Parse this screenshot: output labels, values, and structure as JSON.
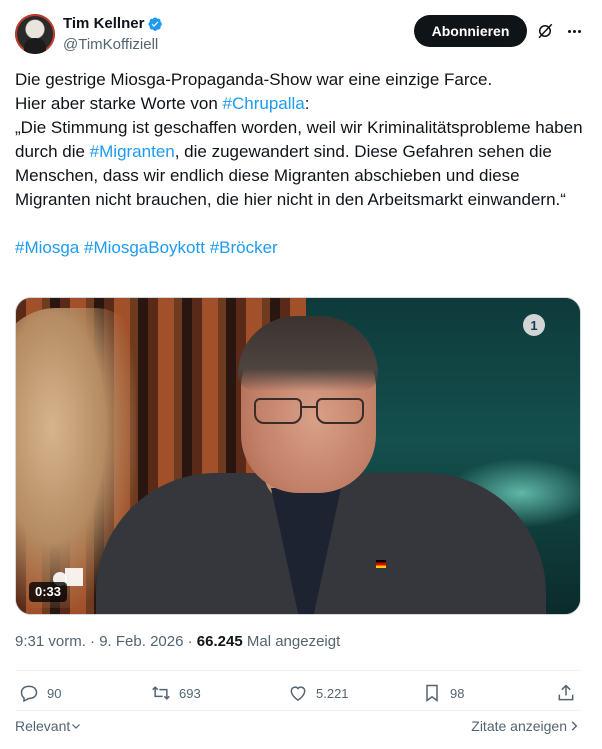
{
  "author": {
    "display_name": "Tim Kellner",
    "handle": "@TimKoffiziell",
    "verified": true
  },
  "header": {
    "subscribe_label": "Abonnieren",
    "icons": [
      "verified-badge-icon",
      "grok-icon",
      "more-icon"
    ]
  },
  "tweet": {
    "line1": "Die gestrige Miosga-Propaganda-Show war eine einzige Farce.",
    "line2_prefix": "Hier aber starke Worte von ",
    "line2_tag": "#Chrupalla",
    "line2_suffix": ":",
    "quote_part1": "„Die Stimmung ist geschaffen worden, weil wir Kriminalitätsprobleme haben durch die ",
    "quote_tag": "#Migranten",
    "quote_part2": ", die zugewandert sind. Diese Gefahren sehen die Menschen, dass wir endlich diese Migranten abschieben und diese Migranten nicht brauchen, die hier nicht in den Arbeitsmarkt einwandern.“",
    "hashtags": [
      "#Miosga",
      "#MiosgaBoykott",
      "#Bröcker"
    ]
  },
  "media": {
    "type": "video",
    "duration": "0:33",
    "channel_logo": "1"
  },
  "meta": {
    "time": "9:31 vorm.",
    "separator": "·",
    "date": "9. Feb. 2026",
    "views": "66.245",
    "views_label": "Mal angezeigt"
  },
  "actions": {
    "replies": "90",
    "reposts": "693",
    "likes": "5.221",
    "bookmarks": "98"
  },
  "footer": {
    "relevant_label": "Relevant",
    "quotes_label": "Zitate anzeigen"
  },
  "colors": {
    "accent": "#1d9bf0",
    "text": "#0f1419",
    "muted": "#536471",
    "button_bg": "#0f1419"
  }
}
